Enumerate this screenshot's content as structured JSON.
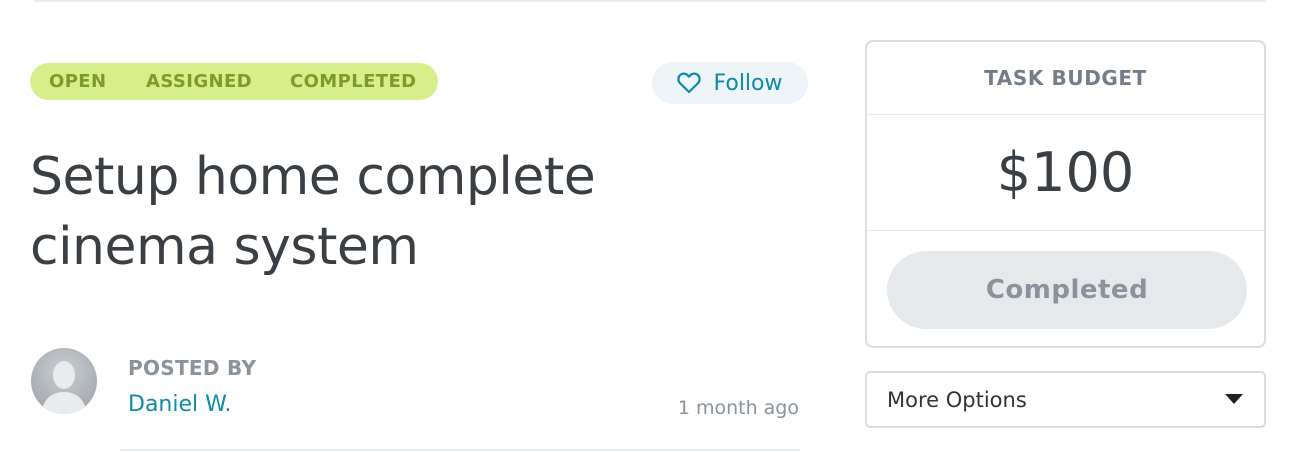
{
  "status": {
    "steps": [
      "OPEN",
      "ASSIGNED",
      "COMPLETED"
    ],
    "current": "COMPLETED",
    "track_color": "#d6ef8a",
    "text_color": "#7b9b2a"
  },
  "follow": {
    "label": "Follow",
    "icon": "heart-outline-icon"
  },
  "task": {
    "title": "Setup home complete cinema system"
  },
  "poster": {
    "label": "POSTED BY",
    "name": "Daniel W.",
    "time": "1 month ago",
    "avatar_icon": "default-avatar-icon"
  },
  "budget": {
    "label": "TASK BUDGET",
    "amount": "$100",
    "action_label": "Completed"
  },
  "more_options": {
    "label": "More Options",
    "icon": "caret-down-icon"
  },
  "colors": {
    "accent": "#0f8aa8",
    "muted": "#8a939b"
  }
}
